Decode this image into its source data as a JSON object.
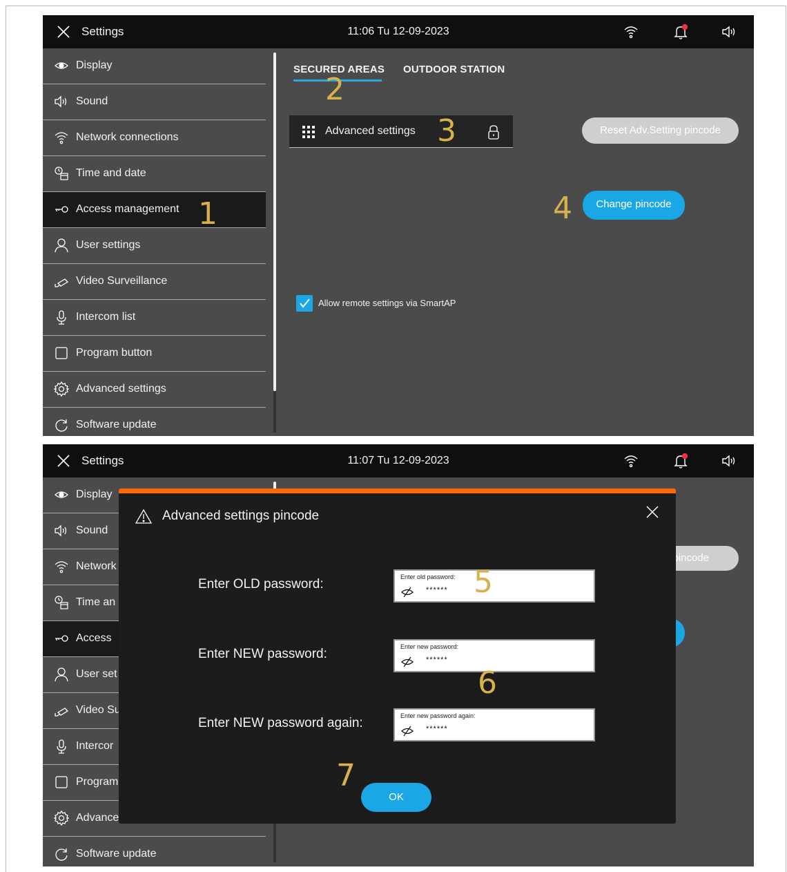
{
  "screen1": {
    "topbar": {
      "title": "Settings",
      "clock": "11:06  Tu 12-09-2023"
    },
    "sidebar": {
      "items": [
        {
          "label": "Display",
          "icon": "eye-icon"
        },
        {
          "label": "Sound",
          "icon": "speaker-icon"
        },
        {
          "label": "Network connections",
          "icon": "wifi-icon"
        },
        {
          "label": "Time and date",
          "icon": "clock-calendar-icon"
        },
        {
          "label": "Access  management",
          "icon": "key-icon",
          "active": true
        },
        {
          "label": "User settings",
          "icon": "user-icon"
        },
        {
          "label": "Video Surveillance",
          "icon": "camera-icon"
        },
        {
          "label": "Intercom list",
          "icon": "microphone-icon"
        },
        {
          "label": "Program button",
          "icon": "square-icon"
        },
        {
          "label": "Advanced settings",
          "icon": "gear-icon"
        },
        {
          "label": "Software update",
          "icon": "refresh-icon"
        }
      ]
    },
    "tabs": {
      "secured": "SECURED AREAS",
      "outdoor": "OUTDOOR STATION"
    },
    "adv_row": {
      "label": "Advanced settings"
    },
    "reset_button": "Reset Adv.Setting pincode",
    "change_button": "Change pincode",
    "remote_checkbox": {
      "label": "Allow remote settings via SmartAP",
      "checked": true
    }
  },
  "screen2": {
    "topbar": {
      "title": "Settings",
      "clock": "11:07  Tu 12-09-2023"
    },
    "sidebar": {
      "items": [
        {
          "label": "Display"
        },
        {
          "label": "Sound"
        },
        {
          "label": "Network"
        },
        {
          "label": "Time an"
        },
        {
          "label": "Access"
        },
        {
          "label": "User set"
        },
        {
          "label": "Video Su"
        },
        {
          "label": "Intercor"
        },
        {
          "label": "Program"
        },
        {
          "label": "Advanced settings"
        },
        {
          "label": "Software update"
        }
      ]
    },
    "bg_reset_fragment": "g pincode",
    "dialog": {
      "title": "Advanced settings pincode",
      "fields": [
        {
          "label": "Enter OLD password:",
          "placeholder": "Enter old password:",
          "value": "******"
        },
        {
          "label": "Enter NEW password:",
          "placeholder": "Enter new password:",
          "value": "******"
        },
        {
          "label": "Enter NEW password again:",
          "placeholder": "Enter new password again:",
          "value": "******"
        }
      ],
      "ok": "OK"
    }
  },
  "callouts": [
    "1",
    "2",
    "3",
    "4",
    "5",
    "6",
    "7"
  ],
  "colors": {
    "accent": "#1ba7e6",
    "dialog_border": "#ff6a00",
    "callout": "#d7b24c",
    "notification": "#e8323c"
  }
}
